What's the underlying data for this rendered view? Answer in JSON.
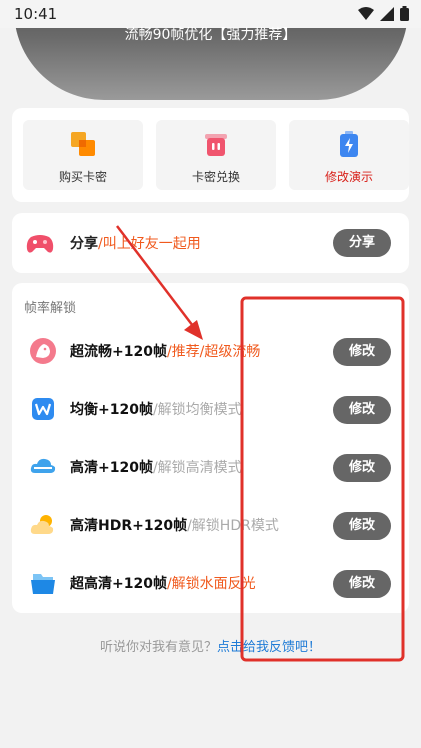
{
  "status": {
    "time": "10:41"
  },
  "hero": {
    "text": "流畅90帧优化【强力推荐】"
  },
  "quick": [
    {
      "label": "购买卡密",
      "icon": "cards-icon",
      "color": "#333333"
    },
    {
      "label": "卡密兑换",
      "icon": "exchange-icon",
      "color": "#333333"
    },
    {
      "label": "修改演示",
      "icon": "battery-bolt-icon",
      "color": "#d8201a"
    }
  ],
  "share": {
    "title": "分享",
    "subtitle": "/叫上好友一起用",
    "button": "分享",
    "icon": "gamepad-icon"
  },
  "unlock": {
    "section": "帧率解锁",
    "rows": [
      {
        "title": "超流畅+120帧",
        "sub": "/推荐/超级流畅",
        "button": "修改",
        "icon": "bird-icon"
      },
      {
        "title": "均衡+120帧",
        "sub": "/解锁均衡模式",
        "button": "修改",
        "icon": "w-icon"
      },
      {
        "title": "高清+120帧",
        "sub": "/解锁高清模式",
        "button": "修改",
        "icon": "cloud-blue-icon"
      },
      {
        "title": "高清HDR+120帧",
        "sub": "/解锁HDR模式",
        "button": "修改",
        "icon": "cloud-orange-icon"
      },
      {
        "title": "超高清+120帧",
        "sub": "/解锁水面反光",
        "button": "修改",
        "icon": "folder-icon"
      }
    ]
  },
  "footer": {
    "text": "听说你对我有意见？",
    "link": "点击给我反馈吧！"
  }
}
